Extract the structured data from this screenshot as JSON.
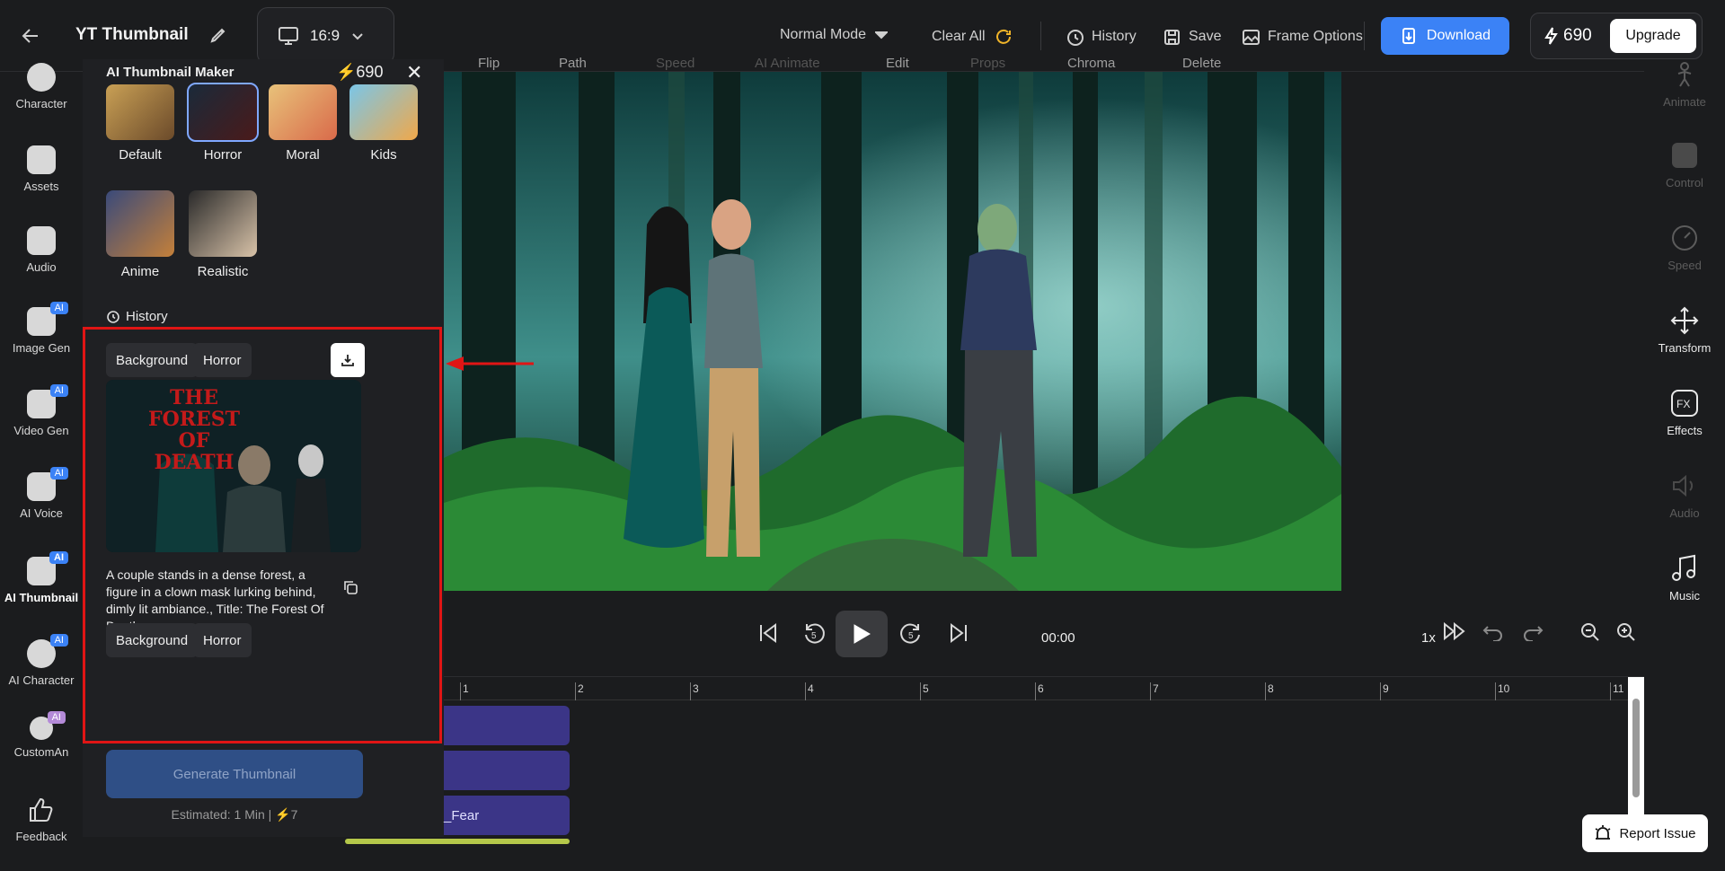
{
  "header": {
    "title": "YT Thumbnail",
    "aspect_ratio": "16:9",
    "mode": "Normal Mode",
    "clear_all": "Clear All",
    "history": "History",
    "save": "Save",
    "frame_options": "Frame Options",
    "download": "Download",
    "credits": "690",
    "upgrade": "Upgrade"
  },
  "left_sidebar": {
    "items": [
      {
        "label": "Character",
        "ai": ""
      },
      {
        "label": "Assets",
        "ai": ""
      },
      {
        "label": "Audio",
        "ai": ""
      },
      {
        "label": "Image Gen",
        "ai": "AI"
      },
      {
        "label": "Video Gen",
        "ai": "AI"
      },
      {
        "label": "AI Voice",
        "ai": "AI"
      },
      {
        "label": "AI Thumbnail",
        "ai": "AI"
      },
      {
        "label": "AI Character",
        "ai": "AI"
      },
      {
        "label": "CustomAn",
        "ai": "AI"
      },
      {
        "label": "Feedback",
        "ai": ""
      }
    ]
  },
  "panel": {
    "title": "AI Thumbnail Maker",
    "credits": "690",
    "styles": [
      {
        "label": "Default"
      },
      {
        "label": "Horror"
      },
      {
        "label": "Moral"
      },
      {
        "label": "Kids"
      },
      {
        "label": "Anime"
      },
      {
        "label": "Realistic"
      }
    ],
    "history_label": "History",
    "history_item": {
      "tags_top": [
        "Background",
        "Horror"
      ],
      "image_title_line1": "THE FOREST",
      "image_title_line2": "OF DEATH",
      "prompt": "A couple stands in a dense forest, a figure in a clown mask lurking behind, dimly lit ambiance., Title: The Forest Of Death",
      "tags_bottom": [
        "Background",
        "Horror"
      ]
    },
    "generate_button": "Generate Thumbnail",
    "estimated": "Estimated: 1 Min",
    "cost": "7"
  },
  "canvas_toolbar": {
    "items": [
      "Flip",
      "Path",
      "Speed",
      "AI Animate",
      "Edit",
      "Props",
      "Chroma",
      "Delete"
    ]
  },
  "player": {
    "time": "00:00",
    "rate": "1x"
  },
  "timeline": {
    "ticks": [
      "1",
      "2",
      "3",
      "4",
      "5",
      "6",
      "7",
      "8",
      "9",
      "10",
      "11"
    ],
    "clips": [
      "",
      "",
      "_Fear"
    ]
  },
  "right_sidebar": {
    "items": [
      {
        "label": "Animate",
        "enabled": false
      },
      {
        "label": "Control",
        "enabled": false
      },
      {
        "label": "Speed",
        "enabled": false
      },
      {
        "label": "Transform",
        "enabled": true
      },
      {
        "label": "Effects",
        "enabled": true
      },
      {
        "label": "Audio",
        "enabled": false
      },
      {
        "label": "Music",
        "enabled": true
      }
    ]
  },
  "report_issue": "Report Issue"
}
